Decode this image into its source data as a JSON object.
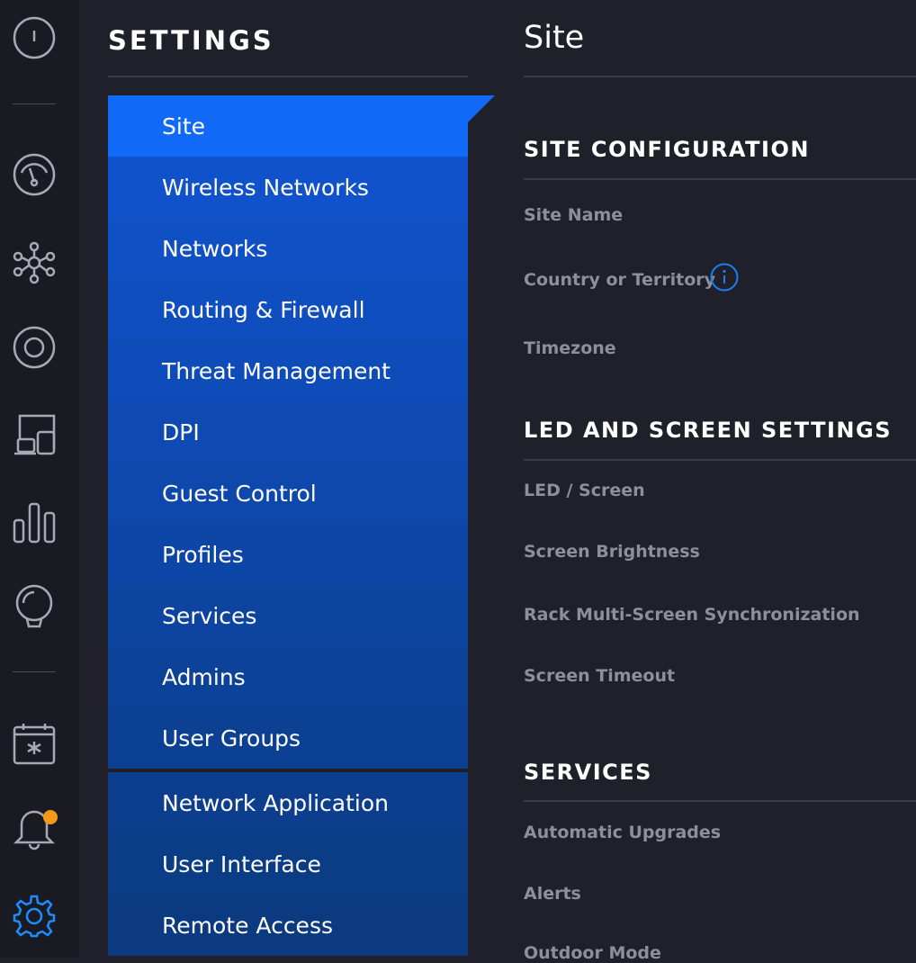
{
  "rail": {
    "icons": [
      "power-icon",
      "dashboard-gauge-icon",
      "topology-icon",
      "devices-icon",
      "clients-icon",
      "statistics-icon",
      "insights-icon",
      "events-calendar-icon",
      "alerts-bell-icon",
      "settings-gear-icon"
    ],
    "badge_color": "#f39a1b"
  },
  "settings": {
    "title": "SETTINGS",
    "active_color": "#1169f7",
    "items": [
      {
        "label": "Site",
        "active": true
      },
      {
        "label": "Wireless Networks"
      },
      {
        "label": "Networks"
      },
      {
        "label": "Routing & Firewall"
      },
      {
        "label": "Threat Management"
      },
      {
        "label": "DPI"
      },
      {
        "label": "Guest Control"
      },
      {
        "label": "Profiles"
      },
      {
        "label": "Services"
      },
      {
        "label": "Admins"
      },
      {
        "label": "User Groups"
      }
    ],
    "items2": [
      {
        "label": "Network Application"
      },
      {
        "label": "User Interface"
      },
      {
        "label": "Remote Access"
      }
    ]
  },
  "main": {
    "title": "Site",
    "sections": [
      {
        "title": "SITE CONFIGURATION",
        "fields": [
          "Site Name",
          "Country or Territory",
          "Timezone"
        ]
      },
      {
        "title": "LED AND SCREEN SETTINGS",
        "fields": [
          "LED / Screen",
          "Screen Brightness",
          "Rack Multi-Screen Synchronization",
          "Screen Timeout"
        ]
      },
      {
        "title": "SERVICES",
        "fields": [
          "Automatic Upgrades",
          "Alerts",
          "Outdoor Mode"
        ]
      }
    ]
  }
}
